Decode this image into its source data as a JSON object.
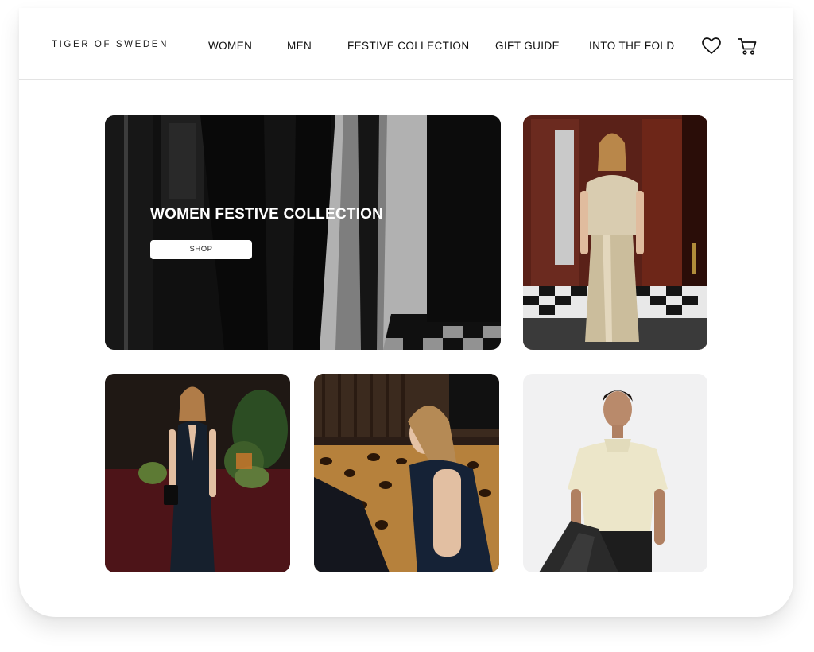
{
  "brand": {
    "logo_text": "TIGER OF SWEDEN"
  },
  "nav": {
    "items": [
      {
        "label": "WOMEN"
      },
      {
        "label": "MEN"
      },
      {
        "label": "FESTIVE COLLECTION"
      },
      {
        "label": "GIFT GUIDE"
      },
      {
        "label": "INTO THE FOLD"
      }
    ],
    "icons": [
      "heart-icon",
      "cart-icon"
    ]
  },
  "hero": {
    "title": "WOMEN FESTIVE COLLECTION",
    "button_label": "SHOP"
  },
  "colors": {
    "text": "#111111",
    "header_border": "#e3e3e3",
    "hero_bg": "#121212",
    "button_bg": "#ffffff"
  }
}
